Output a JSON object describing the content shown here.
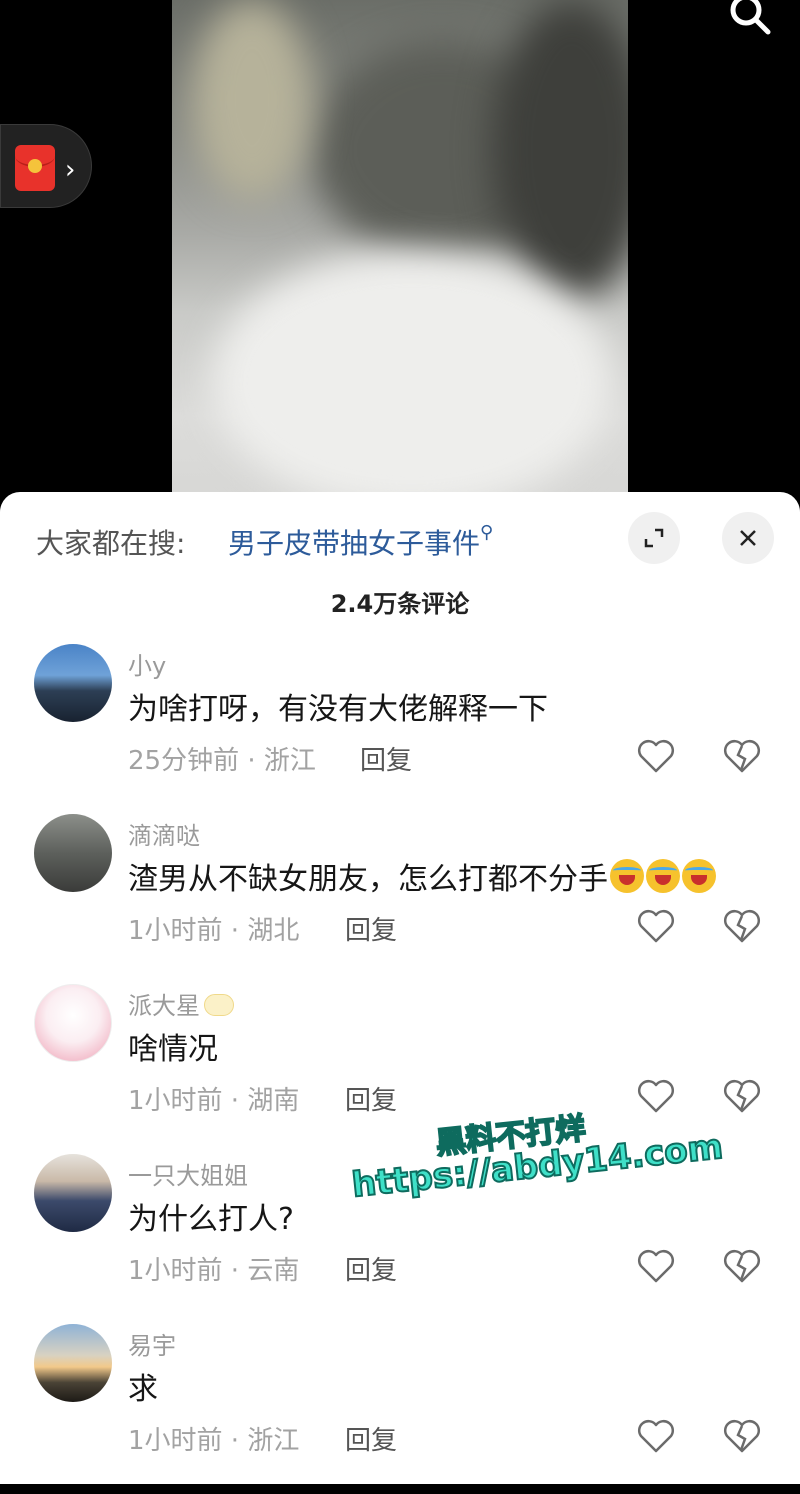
{
  "colors": {
    "accent_link": "#2d5b9a",
    "watermark": "#3fe0c8",
    "red_packet": "#e8322b"
  },
  "video": {
    "search_icon": "search-icon",
    "red_packet_icon": "red-packet-icon"
  },
  "search_bar": {
    "prefix": "大家都在搜:",
    "query": "男子皮带抽女子事件"
  },
  "comments_header": {
    "count": "2.4万条评论"
  },
  "comments": [
    {
      "username": "小y",
      "text": "为啥打呀，有没有大佬解释一下",
      "time": "25分钟前",
      "location": "浙江",
      "reply": "回复",
      "emoji_count": 0,
      "name_badge": false
    },
    {
      "username": "滴滴哒",
      "text": "渣男从不缺女朋友，怎么打都不分手",
      "time": "1小时前",
      "location": "湖北",
      "reply": "回复",
      "emoji_count": 3,
      "name_badge": false
    },
    {
      "username": "派大星",
      "text": "啥情况",
      "time": "1小时前",
      "location": "湖南",
      "reply": "回复",
      "emoji_count": 0,
      "name_badge": true
    },
    {
      "username": "一只大姐姐",
      "text": "为什么打人?",
      "time": "1小时前",
      "location": "云南",
      "reply": "回复",
      "emoji_count": 0,
      "name_badge": false
    },
    {
      "username": "易宇",
      "text": "求",
      "time": "1小时前",
      "location": "浙江",
      "reply": "回复",
      "emoji_count": 0,
      "name_badge": false
    }
  ],
  "watermark": {
    "title": "黑料不打烊",
    "url": "https://abdy14.com"
  }
}
